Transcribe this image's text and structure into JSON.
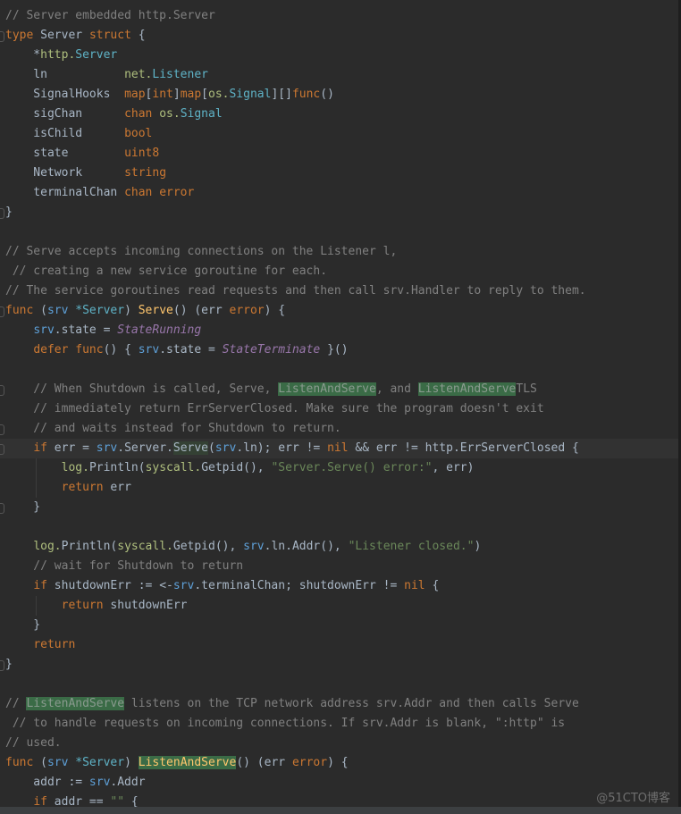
{
  "editor": {
    "language": "go",
    "current_line": 23,
    "colors": {
      "background": "#2b2b2b",
      "comment": "#808080",
      "keyword": "#cc7832",
      "string": "#6a8759",
      "function": "#ffc66d",
      "constant": "#9876aa",
      "highlight": "#3a6b46"
    },
    "lines": [
      [
        [
          "// Server embedded http.Server",
          "cm"
        ]
      ],
      [
        [
          "type",
          "kw"
        ],
        [
          " Server ",
          "pl"
        ],
        [
          "struct",
          "kw"
        ],
        [
          " {",
          "pl"
        ]
      ],
      [
        [
          "    *",
          "pl"
        ],
        [
          "http.",
          "pk"
        ],
        [
          "Server",
          "ty"
        ]
      ],
      [
        [
          "    ln           ",
          "pl"
        ],
        [
          "net.",
          "pk"
        ],
        [
          "Listener",
          "ty"
        ]
      ],
      [
        [
          "    SignalHooks  ",
          "pl"
        ],
        [
          "map",
          "kw"
        ],
        [
          "[",
          "pl"
        ],
        [
          "int",
          "kw"
        ],
        [
          "]",
          "pl"
        ],
        [
          "map",
          "kw"
        ],
        [
          "[",
          "pl"
        ],
        [
          "os.",
          "pk"
        ],
        [
          "Signal",
          "ty"
        ],
        [
          "][]",
          "pl"
        ],
        [
          "func",
          "kw"
        ],
        [
          "()",
          "pl"
        ]
      ],
      [
        [
          "    sigChan      ",
          "pl"
        ],
        [
          "chan",
          "kw"
        ],
        [
          " ",
          "pl"
        ],
        [
          "os.",
          "pk"
        ],
        [
          "Signal",
          "ty"
        ]
      ],
      [
        [
          "    isChild      ",
          "pl"
        ],
        [
          "bool",
          "kw"
        ]
      ],
      [
        [
          "    state        ",
          "pl"
        ],
        [
          "uint8",
          "kw"
        ]
      ],
      [
        [
          "    Network      ",
          "pl"
        ],
        [
          "string",
          "kw"
        ]
      ],
      [
        [
          "    terminalChan ",
          "pl"
        ],
        [
          "chan error",
          "kw"
        ]
      ],
      [
        [
          "}",
          "pl"
        ]
      ],
      [],
      [
        [
          "// Serve accepts incoming connections on the Listener l,",
          "cm"
        ]
      ],
      [
        [
          " // creating a new service goroutine for each.",
          "cm"
        ]
      ],
      [
        [
          "// The service goroutines read requests and then call srv.Handler to reply to them.",
          "cm"
        ]
      ],
      [
        [
          "func",
          "kw"
        ],
        [
          " (",
          "pl"
        ],
        [
          "srv",
          "rv"
        ],
        [
          " ",
          "pl"
        ],
        [
          "*Server",
          "ty"
        ],
        [
          ") ",
          "pl"
        ],
        [
          "Serve",
          "fn"
        ],
        [
          "() (err ",
          "pl"
        ],
        [
          "error",
          "kw"
        ],
        [
          ") {",
          "pl"
        ]
      ],
      [
        [
          "    ",
          "pl"
        ],
        [
          "srv",
          "rv"
        ],
        [
          ".state = ",
          "pl"
        ],
        [
          "StateRunning",
          "ct"
        ]
      ],
      [
        [
          "    ",
          "pl"
        ],
        [
          "defer",
          "kw"
        ],
        [
          " ",
          "pl"
        ],
        [
          "func",
          "kw"
        ],
        [
          "() { ",
          "pl"
        ],
        [
          "srv",
          "rv"
        ],
        [
          ".state = ",
          "pl"
        ],
        [
          "StateTerminate",
          "ct"
        ],
        [
          " }()",
          "pl"
        ]
      ],
      [],
      [
        [
          "    // When Shutdown is called, Serve, ",
          "cm"
        ],
        [
          "ListenAndServe",
          "hlc"
        ],
        [
          ", and ",
          "cm"
        ],
        [
          "ListenAndServe",
          "hlc"
        ],
        [
          "TLS",
          "cm"
        ]
      ],
      [
        [
          "    // immediately return ErrServerClosed. Make sure the program doesn't exit",
          "cm"
        ]
      ],
      [
        [
          "    // and waits instead for Shutdown to return.",
          "cm"
        ]
      ],
      [
        [
          "    ",
          "pl"
        ],
        [
          "if",
          "kw"
        ],
        [
          " err = ",
          "pl"
        ],
        [
          "srv",
          "rv"
        ],
        [
          ".Server.",
          "pl"
        ],
        [
          "Serve",
          "hld"
        ],
        [
          "(",
          "pl"
        ],
        [
          "srv",
          "rv"
        ],
        [
          ".ln); err != ",
          "pl"
        ],
        [
          "nil",
          "kw"
        ],
        [
          " && err != http.ErrServerClosed {",
          "pl"
        ]
      ],
      [
        [
          "        ",
          "pl"
        ],
        [
          "log.",
          "pk"
        ],
        [
          "Println(",
          "pl"
        ],
        [
          "syscall.",
          "pk"
        ],
        [
          "Getpid(), ",
          "pl"
        ],
        [
          "\"Server.Serve() error:\"",
          "st"
        ],
        [
          ", err)",
          "pl"
        ]
      ],
      [
        [
          "        ",
          "pl"
        ],
        [
          "return",
          "kw"
        ],
        [
          " err",
          "pl"
        ]
      ],
      [
        [
          "    }",
          "pl"
        ]
      ],
      [],
      [
        [
          "    ",
          "pl"
        ],
        [
          "log.",
          "pk"
        ],
        [
          "Println(",
          "pl"
        ],
        [
          "syscall.",
          "pk"
        ],
        [
          "Getpid(), ",
          "pl"
        ],
        [
          "srv",
          "rv"
        ],
        [
          ".ln.Addr(), ",
          "pl"
        ],
        [
          "\"Listener closed.\"",
          "st"
        ],
        [
          ")",
          "pl"
        ]
      ],
      [
        [
          "    // wait for Shutdown to return",
          "cm"
        ]
      ],
      [
        [
          "    ",
          "pl"
        ],
        [
          "if",
          "kw"
        ],
        [
          " shutdownErr := <-",
          "pl"
        ],
        [
          "srv",
          "rv"
        ],
        [
          ".terminalChan; shutdownErr != ",
          "pl"
        ],
        [
          "nil",
          "kw"
        ],
        [
          " {",
          "pl"
        ]
      ],
      [
        [
          "        ",
          "pl"
        ],
        [
          "return",
          "kw"
        ],
        [
          " shutdownErr",
          "pl"
        ]
      ],
      [
        [
          "    }",
          "pl"
        ]
      ],
      [
        [
          "    ",
          "pl"
        ],
        [
          "return",
          "kw"
        ]
      ],
      [
        [
          "}",
          "pl"
        ]
      ],
      [],
      [
        [
          "// ",
          "cm"
        ],
        [
          "ListenAndServe",
          "hlc"
        ],
        [
          " listens on the TCP network address srv.Addr and then calls Serve",
          "cm"
        ]
      ],
      [
        [
          " // to handle requests on incoming connections. If srv.Addr is blank, \":http\" is",
          "cm"
        ]
      ],
      [
        [
          "// used.",
          "cm"
        ]
      ],
      [
        [
          "func",
          "kw"
        ],
        [
          " (",
          "pl"
        ],
        [
          "srv",
          "rv"
        ],
        [
          " ",
          "pl"
        ],
        [
          "*Server",
          "ty"
        ],
        [
          ") ",
          "pl"
        ],
        [
          "ListenAndServe",
          "hlf"
        ],
        [
          "() (err ",
          "pl"
        ],
        [
          "error",
          "kw"
        ],
        [
          ") {",
          "pl"
        ]
      ],
      [
        [
          "    addr := ",
          "pl"
        ],
        [
          "srv",
          "rv"
        ],
        [
          ".Addr",
          "pl"
        ]
      ],
      [
        [
          "    ",
          "pl"
        ],
        [
          "if",
          "kw"
        ],
        [
          " addr == ",
          "pl"
        ],
        [
          "\"\"",
          "st"
        ],
        [
          " {",
          "pl"
        ]
      ]
    ]
  },
  "watermark": "@51CTO博客"
}
